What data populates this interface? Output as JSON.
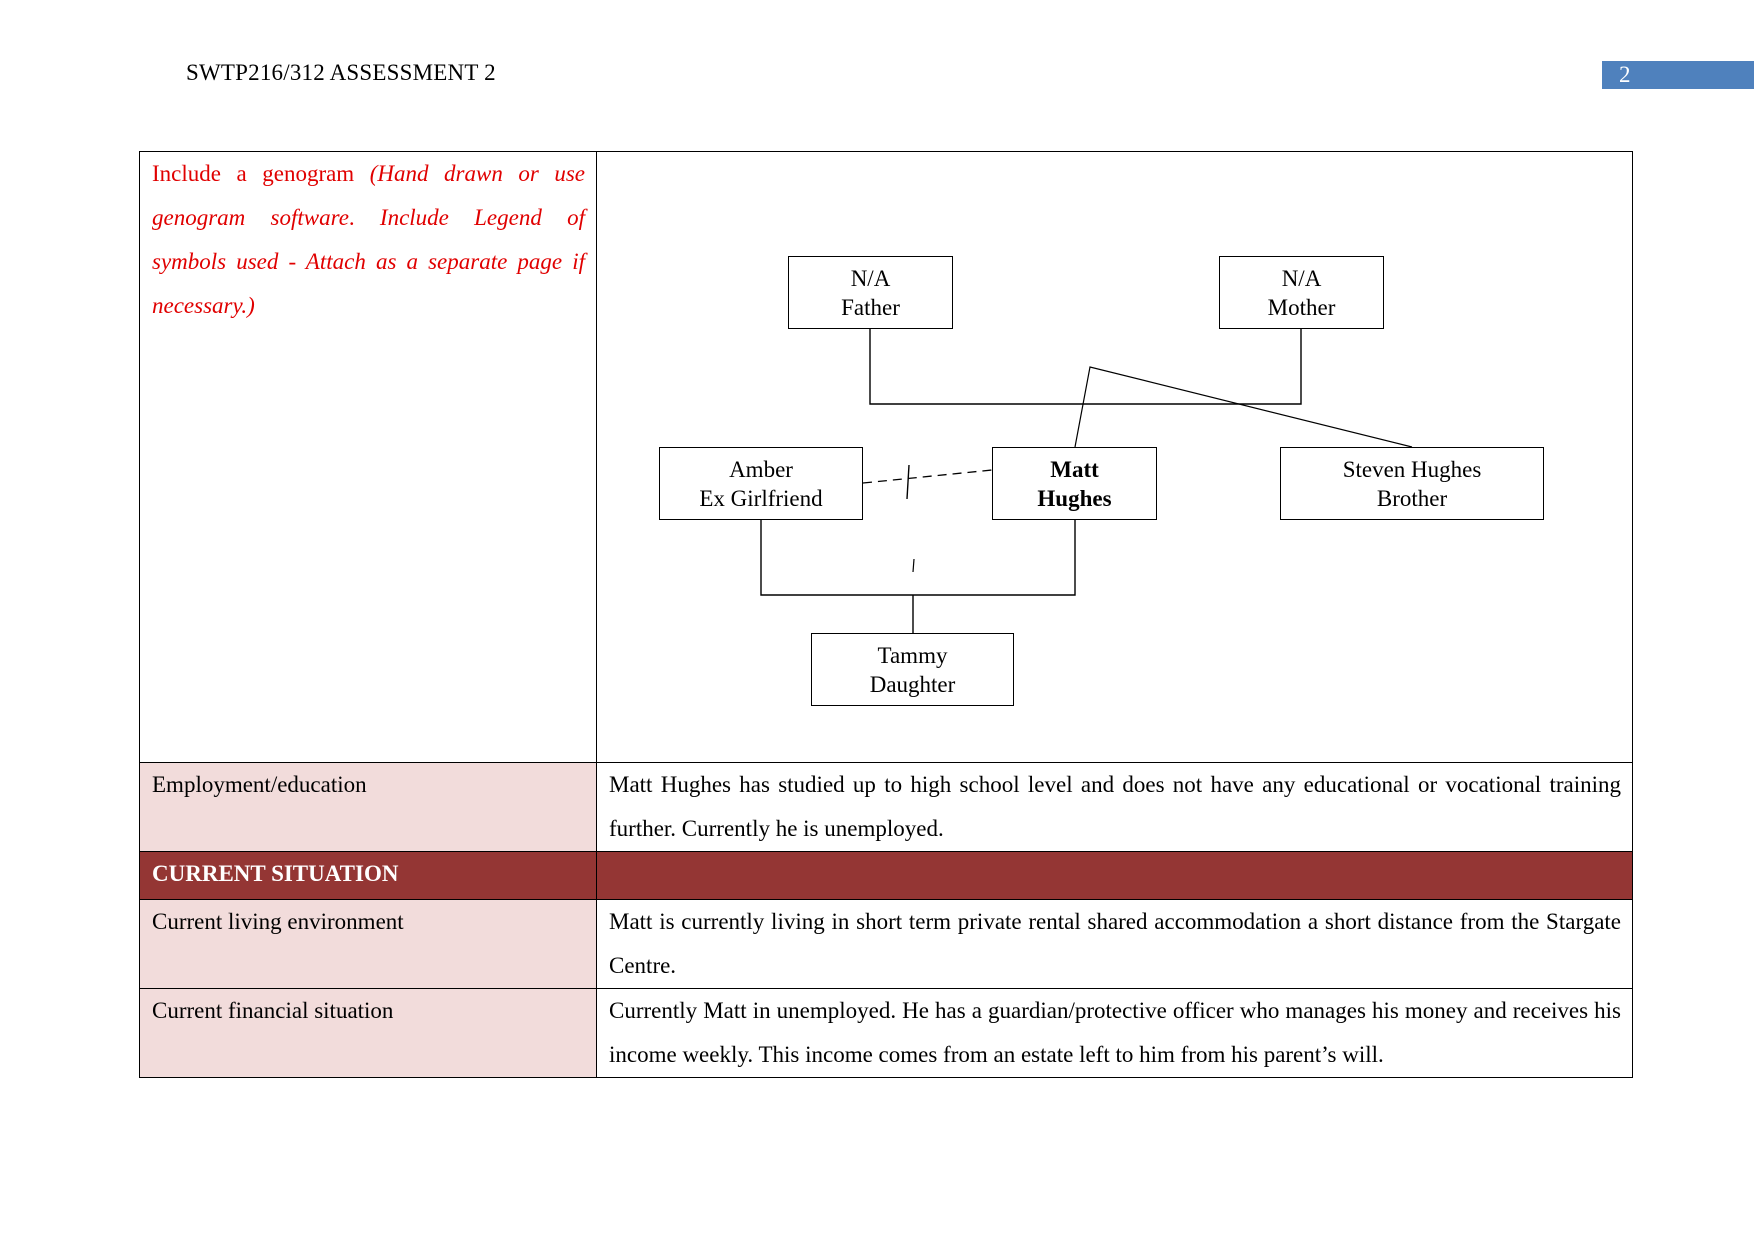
{
  "header": {
    "title": "SWTP216/312 ASSESSMENT 2",
    "page_number": "2",
    "page_number_color": "#4f81bd"
  },
  "genogram_row": {
    "instruction_plain": "Include a genogram ",
    "instruction_italic": "(Hand drawn or use genogram software",
    "instruction_mid": ". ",
    "instruction_italic2": "Include Legend of symbols used - Attach as a separate page if necessary.)",
    "instruction_color": "#e00000"
  },
  "genogram": {
    "people": [
      {
        "id": "father",
        "line1": "N/A",
        "line2": "Father",
        "bold": false
      },
      {
        "id": "mother",
        "line1": "N/A",
        "line2": "Mother",
        "bold": false
      },
      {
        "id": "amber",
        "line1": "Amber",
        "line2": "Ex Girlfriend",
        "bold": false
      },
      {
        "id": "matt",
        "line1": "Matt",
        "line2": "Hughes",
        "bold": true
      },
      {
        "id": "steven",
        "line1": "Steven Hughes",
        "line2": "Brother",
        "bold": false
      },
      {
        "id": "tammy",
        "line1": "Tammy",
        "line2": "Daughter",
        "bold": false
      }
    ],
    "relationships": [
      {
        "type": "marriage",
        "from": "father",
        "to": "mother"
      },
      {
        "type": "child",
        "parents": "father-mother",
        "child": "matt"
      },
      {
        "type": "child",
        "parents": "father-mother",
        "child": "steven"
      },
      {
        "type": "separated-relationship",
        "from": "amber",
        "to": "matt"
      },
      {
        "type": "child",
        "parents": "amber-matt",
        "child": "tammy"
      }
    ]
  },
  "rows": [
    {
      "label": "Employment/education",
      "value": "Matt Hughes has studied up to high school level and does not have any educational or vocational training further. Currently he is unemployed."
    }
  ],
  "section_header": {
    "label": "CURRENT SITUATION",
    "color": "#943634"
  },
  "current_rows": [
    {
      "label": "Current living environment",
      "value": "Matt is currently living in short term private rental shared accommodation a short distance from the Stargate Centre."
    },
    {
      "label": "Current financial situation",
      "value": "Currently Matt in unemployed. He has a guardian/protective officer who manages his money and receives his income weekly.  This income comes from an estate left to him from his parent’s will."
    }
  ],
  "label_cell_color": "#f2dcdb"
}
